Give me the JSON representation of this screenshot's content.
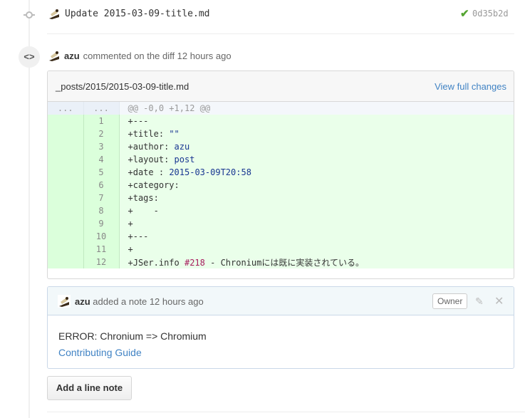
{
  "commit": {
    "title": "Update 2015-03-09-title.md",
    "check": "✔",
    "sha": "0d35b2d"
  },
  "comment_header": {
    "author": "azu",
    "action": "commented on the diff 12 hours ago"
  },
  "file": {
    "path": "_posts/2015/2015-03-09-title.md",
    "view_full_label": "View full changes",
    "hunk": {
      "left": "...",
      "right": "...",
      "text": "@@ -0,0 +1,12 @@"
    },
    "lines": [
      {
        "num": "1",
        "prefix": "+",
        "key": "---",
        "val": ""
      },
      {
        "num": "2",
        "prefix": "+",
        "key": "title:",
        "val": " \"\""
      },
      {
        "num": "3",
        "prefix": "+",
        "key": "author:",
        "val": " azu"
      },
      {
        "num": "4",
        "prefix": "+",
        "key": "layout:",
        "val": " post"
      },
      {
        "num": "5",
        "prefix": "+",
        "key": "date :",
        "val": " 2015-03-09T20:58"
      },
      {
        "num": "6",
        "prefix": "+",
        "key": "category:",
        "val": ""
      },
      {
        "num": "7",
        "prefix": "+",
        "key": "tags:",
        "val": ""
      },
      {
        "num": "8",
        "prefix": "+",
        "key": "    -",
        "val": ""
      },
      {
        "num": "9",
        "prefix": "+",
        "key": "",
        "val": ""
      },
      {
        "num": "10",
        "prefix": "+",
        "key": "---",
        "val": ""
      },
      {
        "num": "11",
        "prefix": "+",
        "key": "",
        "val": ""
      },
      {
        "num": "12",
        "prefix": "+",
        "key": "JSer.info ",
        "ref": "#218",
        "val": " - Chroniumには既に実装されている。"
      }
    ]
  },
  "note": {
    "author": "azu",
    "action": "added a note 12 hours ago",
    "owner_label": "Owner",
    "body": "ERROR: Chronium => Chromium",
    "link": "Contributing Guide"
  },
  "add_line_note_label": "Add a line note",
  "colors": {
    "link": "#4183c4",
    "added_bg": "#eaffea",
    "check": "#55a532"
  }
}
